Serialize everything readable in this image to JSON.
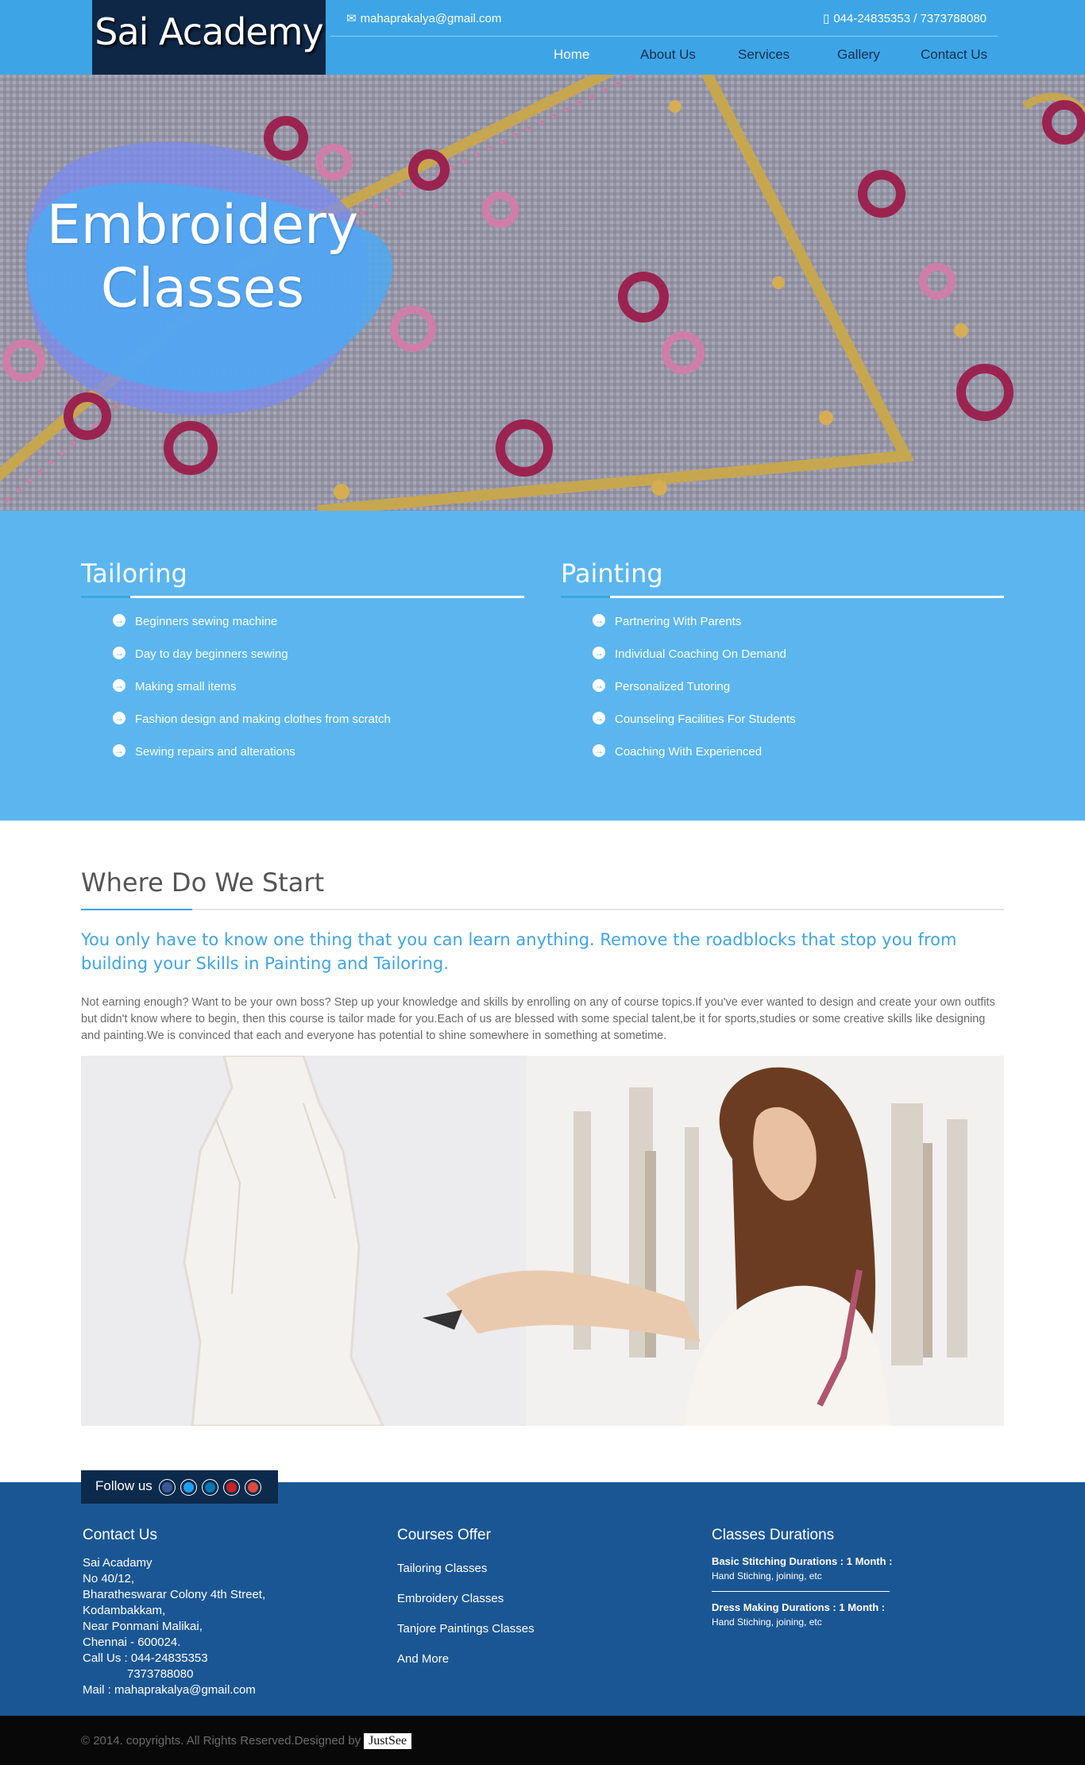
{
  "brand": {
    "name": "Sai Academy"
  },
  "contact_bar": {
    "email": "mahaprakalya@gmail.com",
    "phone": "044-24835353 / 7373788080"
  },
  "nav": {
    "items": [
      {
        "label": "Home"
      },
      {
        "label": "About Us"
      },
      {
        "label": "Services"
      },
      {
        "label": "Gallery"
      },
      {
        "label": "Contact Us"
      }
    ]
  },
  "hero": {
    "title_line1": "Embroidery",
    "title_line2": "Classes"
  },
  "courses": [
    {
      "title": "Tailoring",
      "items": [
        "Beginners sewing machine",
        "Day to day beginners sewing",
        "Making small items",
        "Fashion design and making clothes from scratch",
        "Sewing repairs and alterations"
      ]
    },
    {
      "title": "Painting",
      "items": [
        "Partnering With Parents",
        "Individual Coaching On Demand",
        "Personalized Tutoring",
        "Counseling Facilities For Students",
        "Coaching With Experienced"
      ]
    }
  ],
  "start": {
    "title": "Where Do We Start",
    "lead": "You only have to know one thing that you can learn anything. Remove the roadblocks that stop you from building your Skills in Painting and Tailoring.",
    "paragraph": "Not earning enough? Want to be your own boss? Step up your knowledge and skills by enrolling on any of course topics.If you've ever wanted to design and create your own outfits but didn't know where to begin, then this course is tailor made for you.Each of us are blessed with some special talent,be it for sports,studies or some creative skills like designing and painting.We is convinced that each and everyone has potential to shine somewhere in something at sometime."
  },
  "follow": {
    "label": "Follow us",
    "icons": [
      "facebook-icon",
      "twitter-icon",
      "linkedin-icon",
      "pinterest-icon",
      "google-plus-icon"
    ]
  },
  "footer": {
    "contact": {
      "heading": "Contact Us",
      "lines": [
        "Sai Acadamy",
        "No 40/12,",
        "Bharatheswarar Colony 4th Street,",
        "Kodambakkam,",
        "Near Ponmani Malikai,",
        "Chennai - 600024.",
        "Call Us : 044-24835353",
        "7373788080",
        "Mail : mahaprakalya@gmail.com"
      ]
    },
    "courses": {
      "heading": "Courses Offer",
      "links": [
        "Tailoring Classes",
        "Embroidery Classes",
        "Tanjore Paintings Classes",
        "And More"
      ]
    },
    "durations": {
      "heading": "Classes Durations",
      "entries": [
        {
          "title": "Basic Stitching Durations : 1 Month :",
          "desc": "Hand Stiching, joining, etc"
        },
        {
          "title": "Dress Making Durations : 1 Month :",
          "desc": "Hand Stiching, joining, etc"
        }
      ]
    }
  },
  "copyright": {
    "text": "© 2014. copyrights. All Rights Reserved.Designed by",
    "designer": "JustSee"
  },
  "colors": {
    "header": "#3da5e6",
    "logo_bg": "#0e2746",
    "courses_bg": "#5bb6ef",
    "footer": "#1b5694",
    "bottom_bar": "#080808",
    "accent": "#3da5e6"
  }
}
